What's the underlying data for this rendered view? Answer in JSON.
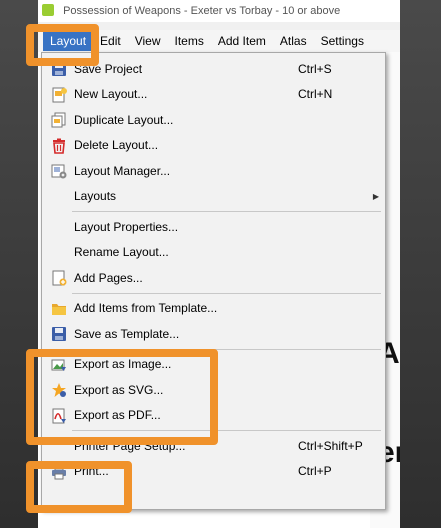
{
  "window": {
    "title": "Possession of Weapons - Exeter vs Torbay - 10 or above"
  },
  "menubar": {
    "items": [
      {
        "label": "Layout",
        "active": true
      },
      {
        "label": "Edit"
      },
      {
        "label": "View"
      },
      {
        "label": "Items"
      },
      {
        "label": "Add Item"
      },
      {
        "label": "Atlas"
      },
      {
        "label": "Settings"
      }
    ]
  },
  "background": {
    "letter_a": "A",
    "letter_er": "er"
  },
  "menu": {
    "save_project": {
      "label": "Save Project",
      "shortcut": "Ctrl+S"
    },
    "new_layout": {
      "label": "New Layout...",
      "shortcut": "Ctrl+N"
    },
    "duplicate_layout": {
      "label": "Duplicate Layout..."
    },
    "delete_layout": {
      "label": "Delete Layout..."
    },
    "layout_manager": {
      "label": "Layout Manager..."
    },
    "layouts": {
      "label": "Layouts"
    },
    "layout_properties": {
      "label": "Layout Properties..."
    },
    "rename_layout": {
      "label": "Rename Layout..."
    },
    "add_pages": {
      "label": "Add Pages..."
    },
    "add_items_from_template": {
      "label": "Add Items from Template..."
    },
    "save_as_template": {
      "label": "Save as Template..."
    },
    "export_as_image": {
      "label": "Export as Image..."
    },
    "export_as_svg": {
      "label": "Export as SVG..."
    },
    "export_as_pdf": {
      "label": "Export as PDF..."
    },
    "printer_page_setup": {
      "label": "Printer Page Setup...",
      "shortcut": "Ctrl+Shift+P"
    },
    "print": {
      "label": "Print...",
      "shortcut": "Ctrl+P"
    }
  },
  "colors": {
    "highlight": "#f0922b",
    "menu_active": "#3873c4"
  }
}
